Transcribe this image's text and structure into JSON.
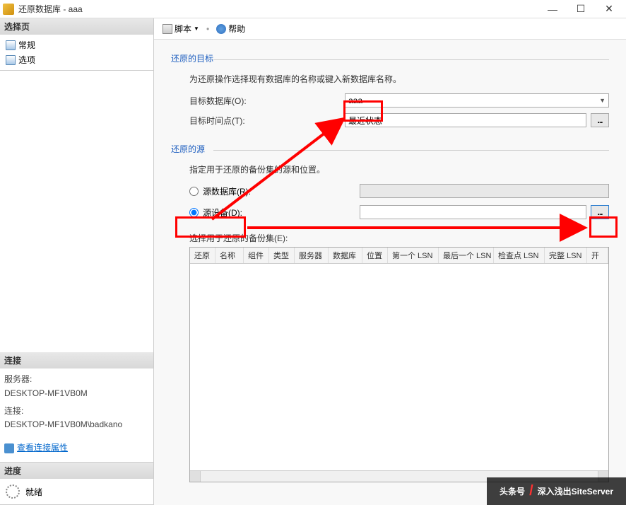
{
  "window": {
    "title": "还原数据库 - aaa",
    "min": "—",
    "max": "☐",
    "close": "✕"
  },
  "sidebar": {
    "select_page": {
      "header": "选择页",
      "items": [
        "常规",
        "选项"
      ]
    },
    "connection": {
      "header": "连接",
      "server_label": "服务器:",
      "server_value": "DESKTOP-MF1VB0M",
      "conn_label": "连接:",
      "conn_value": "DESKTOP-MF1VB0M\\badkano",
      "view_props": "查看连接属性"
    },
    "progress": {
      "header": "进度",
      "status": "就绪"
    }
  },
  "toolbar": {
    "script": "脚本",
    "help": "帮助"
  },
  "target": {
    "legend": "还原的目标",
    "desc": "为还原操作选择现有数据库的名称或键入新数据库名称。",
    "db_label": "目标数据库(O):",
    "db_value": "aaa",
    "time_label": "目标时间点(T):",
    "time_value": "最近状态",
    "browse": "..."
  },
  "source": {
    "legend": "还原的源",
    "desc": "指定用于还原的备份集的源和位置。",
    "radio_db": "源数据库(R):",
    "radio_device": "源设备(D):",
    "browse": "...",
    "sets_label": "选择用于还原的备份集(E):"
  },
  "grid": {
    "cols": [
      "还原",
      "名称",
      "组件",
      "类型",
      "服务器",
      "数据库",
      "位置",
      "第一个 LSN",
      "最后一个 LSN",
      "检查点 LSN",
      "完整 LSN",
      "开"
    ]
  },
  "watermark": {
    "prefix": "头条号",
    "sep": "/",
    "text": "深入浅出SiteServer"
  }
}
